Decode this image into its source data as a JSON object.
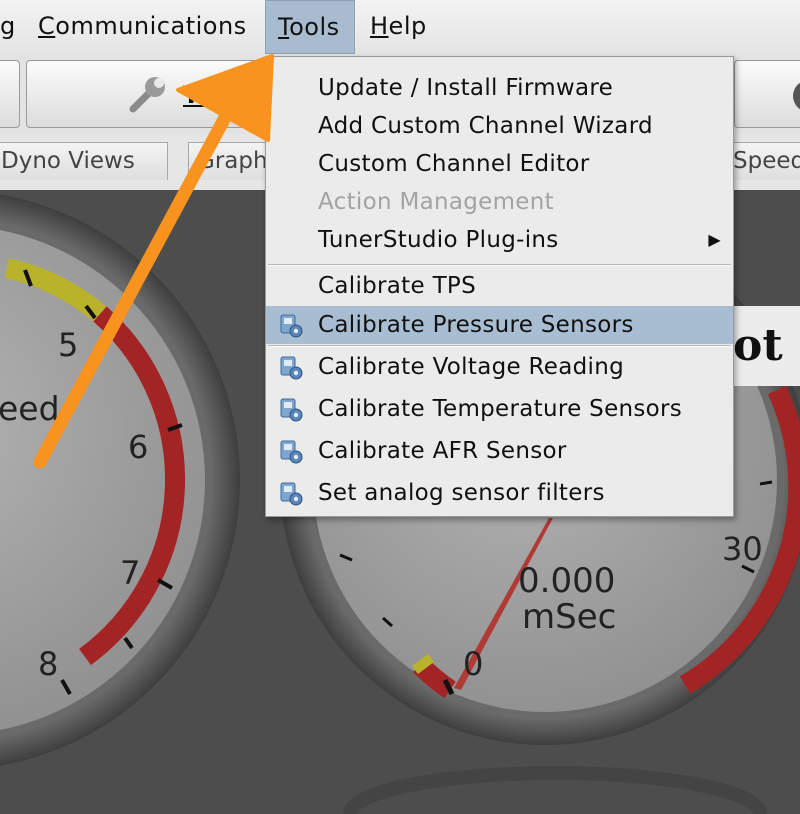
{
  "menubar": {
    "items": [
      {
        "label": "g"
      },
      {
        "label_mnemonic": "C",
        "label_rest": "ommunications"
      },
      {
        "label_mnemonic": "T",
        "label_rest": "ools"
      },
      {
        "label_mnemonic": "H",
        "label_rest": "elp"
      }
    ]
  },
  "toolbar": {
    "tune_label": "Tu"
  },
  "tabs": [
    {
      "label": "Dyno Views"
    },
    {
      "label": "Graph"
    },
    {
      "label": "Speed"
    }
  ],
  "gauges": {
    "left": {
      "ticks": [
        "5",
        "6",
        "7",
        "8"
      ],
      "label": "eed"
    },
    "center": {
      "tick_zero": "0",
      "tick_thirty": "30",
      "value": "0.000",
      "unit": "mSec"
    },
    "banner_text": "ot"
  },
  "tools_menu": {
    "items": [
      {
        "label": "Update / Install Firmware",
        "icon": "none"
      },
      {
        "label": "Add Custom Channel Wizard",
        "icon": "none"
      },
      {
        "label": "Custom Channel Editor",
        "icon": "none"
      },
      {
        "label": "Action Management",
        "icon": "none",
        "disabled": true
      },
      {
        "label": "TunerStudio Plug-ins",
        "icon": "none",
        "submenu": true
      },
      {
        "label": "Calibrate TPS",
        "icon": "none"
      },
      {
        "label": "Calibrate Pressure Sensors",
        "icon": "calibrate-icon",
        "selected": true
      },
      {
        "label": "Calibrate Voltage Reading",
        "icon": "calibrate-icon"
      },
      {
        "label": "Calibrate Temperature Sensors",
        "icon": "calibrate-icon"
      },
      {
        "label": "Calibrate AFR Sensor",
        "icon": "calibrate-icon"
      },
      {
        "label": "Set analog sensor filters",
        "icon": "calibrate-icon"
      }
    ]
  },
  "colors": {
    "menu_highlight": "#a8bdd2",
    "arrow": "#f7931e",
    "gauge_red": "#a32424",
    "gauge_yellow": "#b9b32b"
  }
}
